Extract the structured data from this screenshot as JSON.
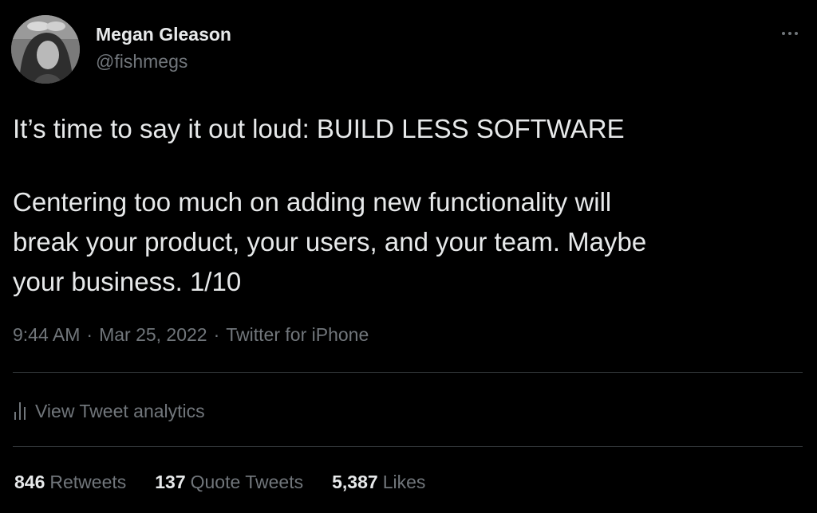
{
  "author": {
    "name": "Megan Gleason",
    "handle": "@fishmegs"
  },
  "tweet": {
    "line1": "It’s time to say it out loud: BUILD LESS SOFTWARE",
    "line2": "Centering too much on adding new functionality will",
    "line3": "break your product, your users, and your team. Maybe",
    "line4": "your business. 1/10"
  },
  "meta": {
    "time": "9:44 AM",
    "separator": "·",
    "date": "Mar 25, 2022",
    "source": "Twitter for iPhone"
  },
  "analytics": {
    "icon": "analytics-bars-icon",
    "label": "View Tweet analytics"
  },
  "stats": {
    "retweets": {
      "count": "846",
      "label": "Retweets"
    },
    "quote_tweets": {
      "count": "137",
      "label": "Quote Tweets"
    },
    "likes": {
      "count": "5,387",
      "label": "Likes"
    }
  },
  "icons": {
    "more": "more-options-icon"
  },
  "colors": {
    "background": "#000000",
    "primary_text": "#e7e9ea",
    "secondary_text": "#71767b",
    "divider": "#2f3336"
  }
}
